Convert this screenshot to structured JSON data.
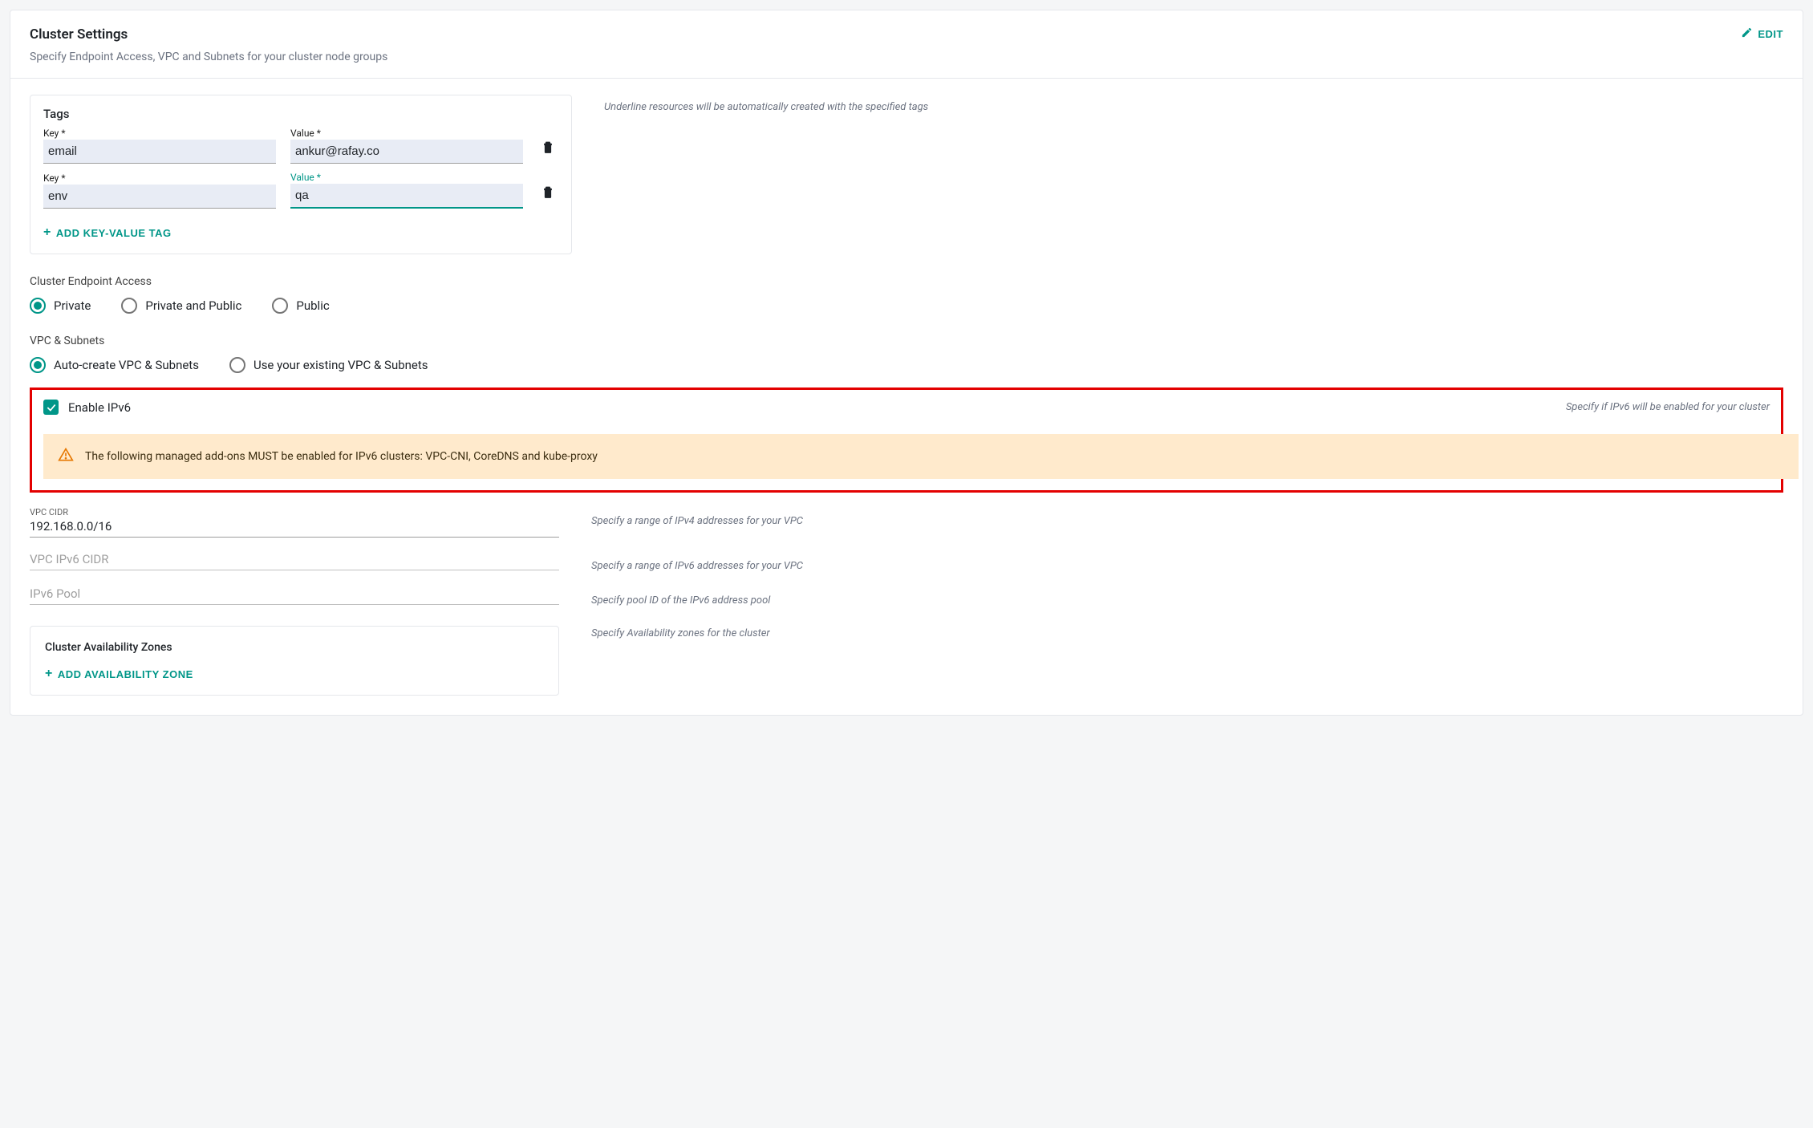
{
  "header": {
    "title": "Cluster Settings",
    "subtitle": "Specify Endpoint Access, VPC and Subnets for your cluster node groups",
    "editLabel": "EDIT"
  },
  "tags": {
    "title": "Tags",
    "keyLabel": "Key *",
    "valueLabel": "Value *",
    "rows": [
      {
        "key": "email",
        "value": "ankur@rafay.co"
      },
      {
        "key": "env",
        "value": "qa"
      }
    ],
    "addButtonLabel": "ADD KEY-VALUE TAG",
    "helper": "Underline resources will be automatically created with the specified tags"
  },
  "endpointAccess": {
    "label": "Cluster Endpoint Access",
    "options": [
      {
        "label": "Private",
        "selected": true
      },
      {
        "label": "Private and Public",
        "selected": false
      },
      {
        "label": "Public",
        "selected": false
      }
    ]
  },
  "vpcSubnets": {
    "label": "VPC & Subnets",
    "options": [
      {
        "label": "Auto-create VPC & Subnets",
        "selected": true
      },
      {
        "label": "Use your existing VPC & Subnets",
        "selected": false
      }
    ]
  },
  "ipv6": {
    "checkboxLabel": "Enable IPv6",
    "helper": "Specify if IPv6 will be enabled for your cluster",
    "alert": "The following managed add-ons MUST be enabled for IPv6 clusters: VPC-CNI, CoreDNS and kube-proxy"
  },
  "vpcCidr": {
    "label": "VPC CIDR",
    "value": "192.168.0.0/16",
    "helper": "Specify a range of IPv4 addresses for your VPC"
  },
  "vpcIpv6Cidr": {
    "placeholder": "VPC IPv6 CIDR",
    "helper": "Specify a range of IPv6 addresses for your VPC"
  },
  "ipv6Pool": {
    "placeholder": "IPv6 Pool",
    "helper": "Specify pool ID of the IPv6 address pool"
  },
  "az": {
    "title": "Cluster Availability Zones",
    "addButtonLabel": "ADD  AVAILABILITY ZONE",
    "helper": "Specify Availability zones for the cluster"
  }
}
